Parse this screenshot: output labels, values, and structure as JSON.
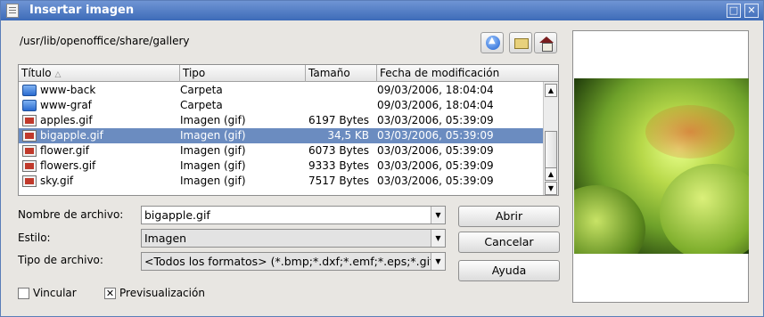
{
  "window": {
    "title": "Insertar imagen"
  },
  "toolbar": {
    "path": "/usr/lib/openoffice/share/gallery"
  },
  "list": {
    "columns": [
      "Título",
      "Tipo",
      "Tamaño",
      "Fecha de modificación"
    ],
    "rows": [
      {
        "name": "www-back",
        "type": "Carpeta",
        "size": "",
        "date": "09/03/2006, 18:04:04",
        "icon": "folder-icon"
      },
      {
        "name": "www-graf",
        "type": "Carpeta",
        "size": "",
        "date": "09/03/2006, 18:04:04",
        "icon": "folder-icon"
      },
      {
        "name": "apples.gif",
        "type": "Imagen (gif)",
        "size": "6197 Bytes",
        "date": "03/03/2006, 05:39:09",
        "icon": "image-file-icon"
      },
      {
        "name": "bigapple.gif",
        "type": "Imagen (gif)",
        "size": "34,5 KB",
        "date": "03/03/2006, 05:39:09",
        "icon": "image-file-icon"
      },
      {
        "name": "flower.gif",
        "type": "Imagen (gif)",
        "size": "6073 Bytes",
        "date": "03/03/2006, 05:39:09",
        "icon": "image-file-icon"
      },
      {
        "name": "flowers.gif",
        "type": "Imagen (gif)",
        "size": "9333 Bytes",
        "date": "03/03/2006, 05:39:09",
        "icon": "image-file-icon"
      },
      {
        "name": "sky.gif",
        "type": "Imagen (gif)",
        "size": "7517 Bytes",
        "date": "03/03/2006, 05:39:09",
        "icon": "image-file-icon"
      }
    ],
    "selected_index": 3
  },
  "form": {
    "filename_label": "Nombre de archivo:",
    "filename_value": "bigapple.gif",
    "style_label": "Estilo:",
    "style_value": "Imagen",
    "filetype_label": "Tipo de archivo:",
    "filetype_value": "<Todos los formatos> (*.bmp;*.dxf;*.emf;*.eps;*.gif"
  },
  "buttons": {
    "open": "Abrir",
    "cancel": "Cancelar",
    "help": "Ayuda"
  },
  "options": {
    "link_label": "Vincular",
    "link_checked": false,
    "preview_label": "Previsualización",
    "preview_checked": true
  },
  "colors": {
    "titlebar": "#3d6bb8",
    "selection": "#6b8cc0"
  }
}
